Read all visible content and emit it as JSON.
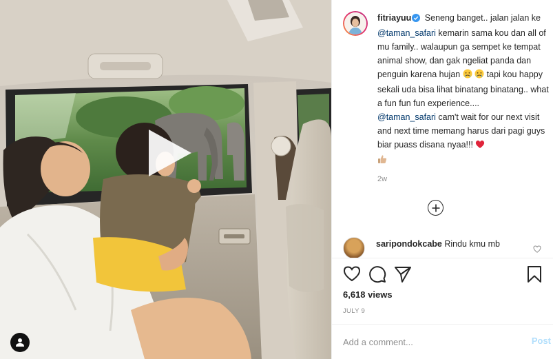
{
  "post": {
    "username": "fitriayuu",
    "caption": {
      "p1": " Seneng banget.. jalan jalan ke ",
      "mention1": "@taman_safari",
      "p2": " kemarin sama kou dan all of mu family.. walaupun ga sempet ke tempat animal show, dan gak ngeliat panda dan penguin karena hujan ",
      "p3": " tapi kou happy sekali uda bisa lihat binatang binatang.. what a fun fun fun experience....",
      "mention2": "@taman_safari",
      "p4": " cam't wait for our next visit and next time memang harus dari pagi guys biar puass disana nyaa!!! "
    },
    "time_ago": "2w"
  },
  "comment": {
    "username": "saripondokcabe",
    "text": " Rindu kmu mb"
  },
  "stats": {
    "views": "6,618 views",
    "date": "JULY 9"
  },
  "add_comment": {
    "placeholder": "Add a comment...",
    "post_label": "Post"
  },
  "icons": {
    "play": "play-icon",
    "user_tag": "user-tag-icon",
    "verified": "verified-badge-icon",
    "load_more": "plus-circle-icon",
    "like": "heart-icon",
    "comment": "comment-bubble-icon",
    "share": "paper-plane-icon",
    "save": "bookmark-icon"
  },
  "colors": {
    "mention": "#00376b",
    "verified": "#3897f0",
    "muted": "#8e8e8e",
    "post_button": "#b2dffc"
  }
}
